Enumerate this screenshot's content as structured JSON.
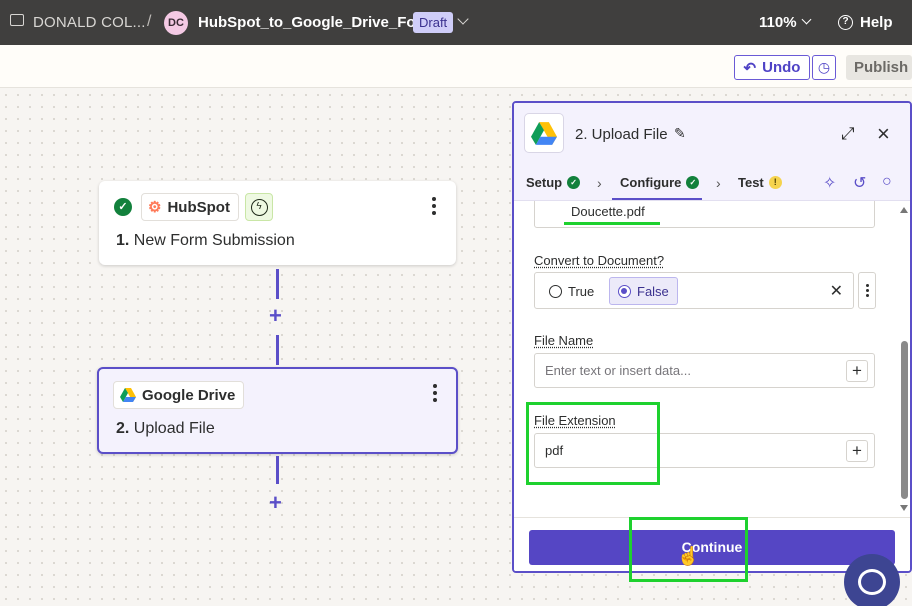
{
  "topbar": {
    "folder": "DONALD COL...",
    "separator": "/",
    "avatar_initials": "DC",
    "zap_name": "HubSpot_to_Google_Drive_Folder",
    "status": "Draft",
    "zoom": "110%",
    "help": "Help"
  },
  "toolbar": {
    "undo": "Undo",
    "publish": "Publish"
  },
  "canvas": {
    "step1": {
      "app": "HubSpot",
      "number": "1.",
      "title": "New Form Submission"
    },
    "step2": {
      "app": "Google Drive",
      "number": "2.",
      "title": "Upload File"
    }
  },
  "panel": {
    "title": "2. Upload File",
    "tabs": [
      "Setup",
      "Configure",
      "Test"
    ],
    "file_value": "Doucette.pdf",
    "convert": {
      "label": "Convert to Document?",
      "option_true": "True",
      "option_false": "False",
      "selected": "False"
    },
    "file_name": {
      "label": "File Name",
      "placeholder": "Enter text or insert data..."
    },
    "file_extension": {
      "label": "File Extension",
      "value": "pdf"
    },
    "continue": "Continue"
  },
  "colors": {
    "accent": "#5b4fc8",
    "topbar": "#403f3e",
    "success": "#12813c",
    "highlight": "#1ed12e"
  }
}
